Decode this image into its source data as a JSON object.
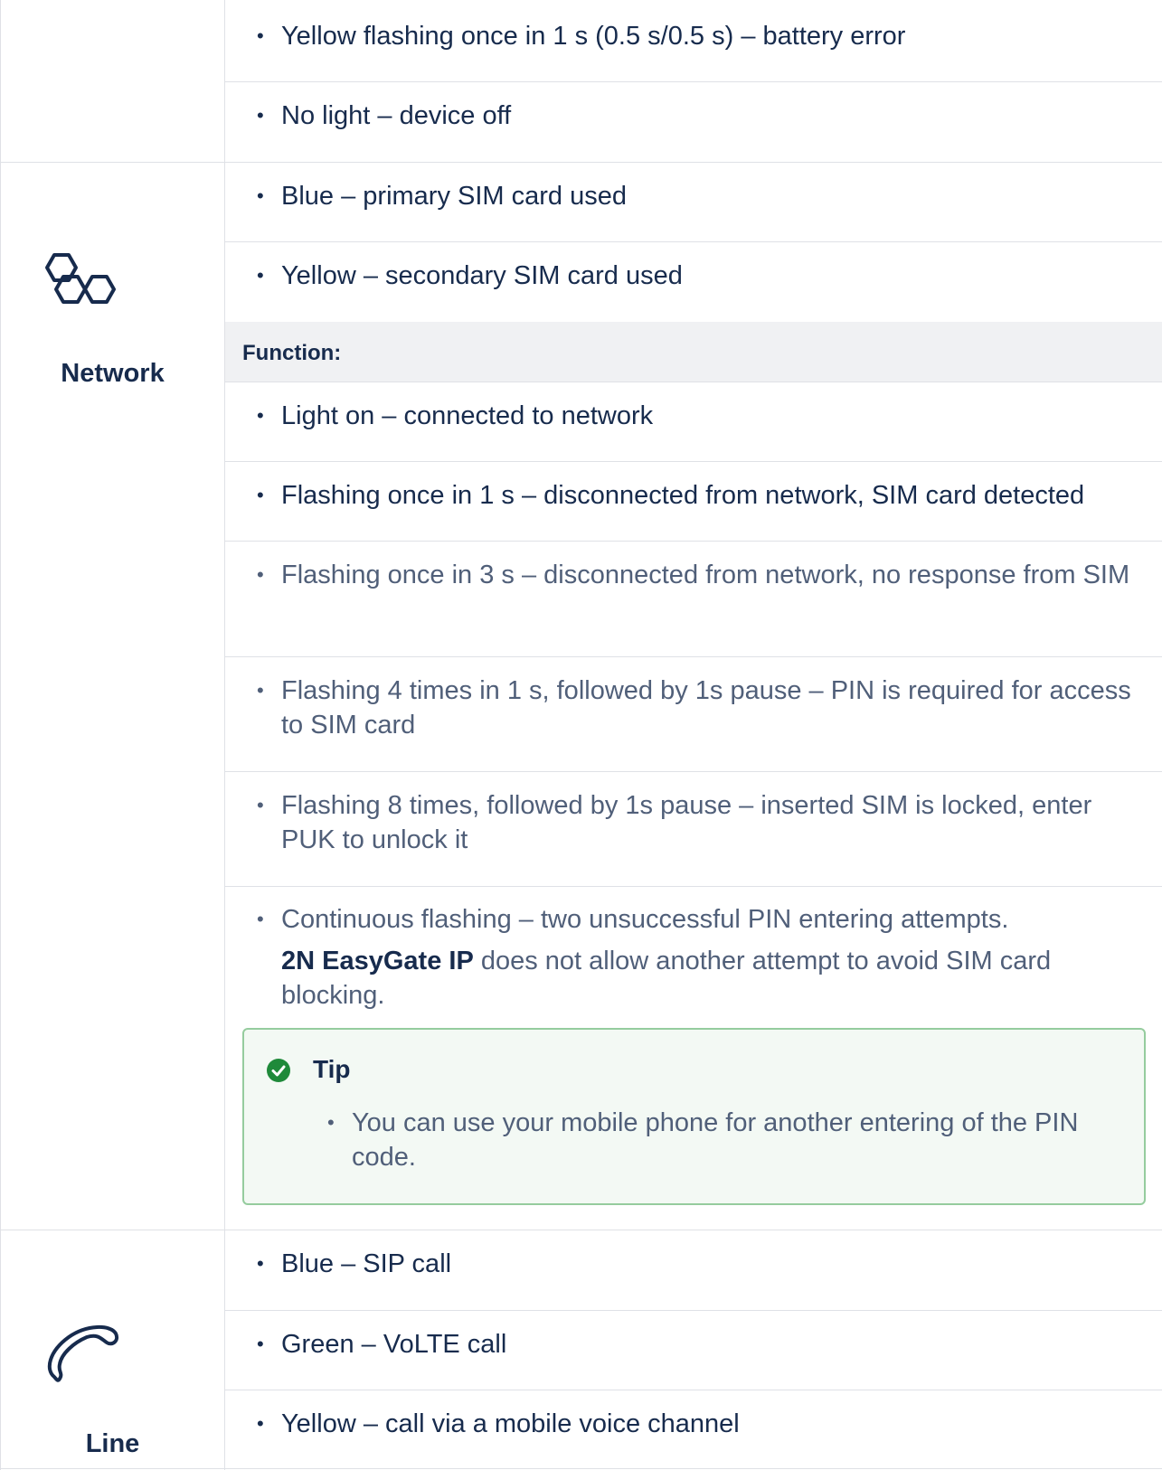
{
  "battery_items": [
    "Yellow flashing once in 1 s (0.5 s/0.5 s) – battery error",
    "No light – device off"
  ],
  "network": {
    "label": "Network",
    "icon": "hexagons-network-icon",
    "color_items": [
      "Blue – primary SIM card used",
      "Yellow – secondary SIM card used"
    ],
    "function_label": "Function:",
    "function_items": [
      "Light on – connected to network",
      "Flashing once in 1 s – disconnected from network, SIM card detected",
      "Flashing once in 3 s – disconnected from network, no response from SIM",
      "Flashing 4 times in 1 s, followed by 1s pause – PIN is required for access to SIM card",
      "Flashing 8 times, followed by 1s pause – inserted SIM is locked, enter PUK to unlock it"
    ],
    "continuous": {
      "text": "Continuous flashing –  two unsuccessful PIN entering attempts.",
      "product": "2N EasyGate IP",
      "rest": " does not allow another attempt to avoid SIM card blocking."
    },
    "tip": {
      "title": "Tip",
      "icon": "check-circle-icon",
      "items": [
        "You can use your mobile phone for another entering of the PIN code."
      ]
    }
  },
  "line": {
    "label": "Line",
    "icon": "phone-handset-icon",
    "items": [
      "Blue – SIP call",
      "Green – VoLTE call",
      "Yellow – call via a mobile voice channel"
    ]
  },
  "colors": {
    "tip_border": "#95cc9e",
    "tip_bg": "#f3f9f4",
    "tip_icon": "#1f8a3a",
    "function_bg": "#f0f1f3"
  }
}
